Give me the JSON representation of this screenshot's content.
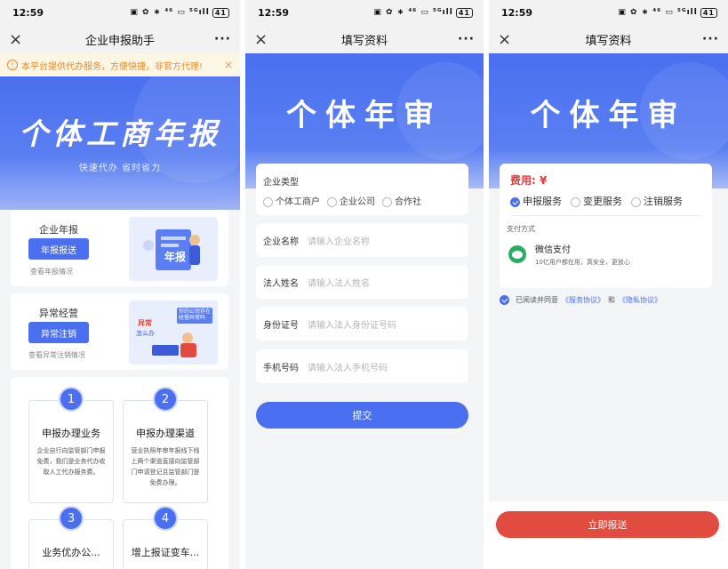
{
  "screen1": {
    "status": {
      "time": "12:59",
      "icons": "▣ ✿ ∗ ⁴⁶ ▭ ⁵ᴳıll",
      "battery": "41"
    },
    "titlebar": {
      "close": "×",
      "title": "企业申报助手",
      "more": "···"
    },
    "notice": {
      "icon": "!",
      "text": "本平台提供代办服务，方便快捷，非官方代理!",
      "close": "×"
    },
    "hero": {
      "title": "个体工商年报",
      "slogan": "快速代办 省时省力"
    },
    "card_annual": {
      "title": "企业年报",
      "button": "年报报送",
      "sub": "查看年报情况",
      "illus_text": "年报"
    },
    "card_abnormal": {
      "title": "异常经营",
      "button": "异常注销",
      "sub": "查看异常注销情况",
      "illus_text1": "异常",
      "illus_text2": "怎么办",
      "illus_text3": "你的公司存在经营异常吗"
    },
    "features": [
      {
        "num": "1",
        "title": "申报办理业务",
        "desc": "企业自行向监管部门申报免费，我们是业务代办收取人工代办服务费。"
      },
      {
        "num": "2",
        "title": "申报办理渠道",
        "desc": "营业执照年审年报线下线上两个渠道直接向监管部门申请登记且监管部门是免费办理。"
      },
      {
        "num": "3",
        "title": "业务优办公...",
        "desc": ""
      },
      {
        "num": "4",
        "title": "增上报证变车...",
        "desc": ""
      }
    ]
  },
  "screen2": {
    "status": {
      "time": "12:59",
      "icons": "▣ ✿ ∗ ⁴⁶ ▭ ⁵ᴳıll",
      "battery": "41"
    },
    "titlebar": {
      "close": "×",
      "title": "填写资料",
      "more": "···"
    },
    "hero": {
      "title": "个体年审"
    },
    "form": {
      "type_label": "企业类型",
      "type_options": [
        "个体工商户",
        "企业公司",
        "合作社"
      ],
      "name_label": "企业名称",
      "name_placeholder": "请输入企业名称",
      "person_label": "法人姓名",
      "person_placeholder": "请输入法人姓名",
      "id_label": "身份证号",
      "id_placeholder": "请输入法人身份证号码",
      "phone_label": "手机号码",
      "phone_placeholder": "请输入法人手机号码",
      "submit": "提交"
    }
  },
  "screen3": {
    "status": {
      "time": "12:59",
      "icons": "▣ ✿ ∗ ⁴⁶ ▭ ⁵ᴳıll",
      "battery": "41"
    },
    "titlebar": {
      "close": "×",
      "title": "填写资料",
      "more": "···"
    },
    "hero": {
      "title": "个体年审"
    },
    "fee_label": "费用: ¥",
    "services": [
      "申报服务",
      "变更服务",
      "注销服务"
    ],
    "pay_method_label": "支付方式",
    "wechat_title": "微信支付",
    "wechat_desc": "10亿用户都在用，真安全，更放心",
    "agree_prefix": "已阅读并同意",
    "agree_link1": "《服务协议》",
    "agree_and": "和",
    "agree_link2": "《隐私协议》",
    "pay_button": "立即报送"
  },
  "colors": {
    "primary": "#4a6ff0",
    "danger": "#e24b3f",
    "wechat": "#2aae67",
    "notice_text": "#e6892b"
  }
}
